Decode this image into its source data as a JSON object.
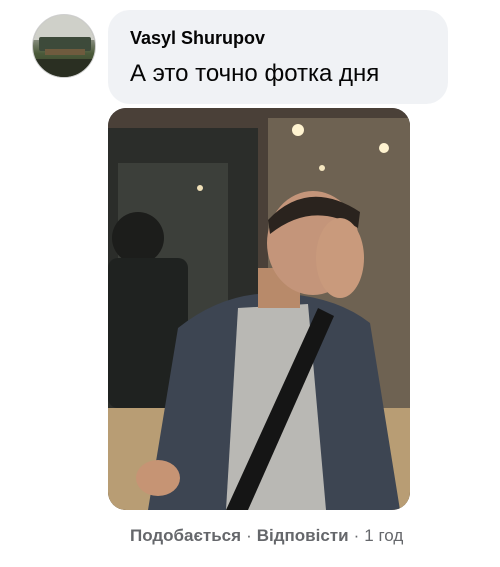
{
  "comment": {
    "author": "Vasyl Shurupov",
    "text": "А это точно фотка дня",
    "actions": {
      "like_label": "Подобається",
      "reply_label": "Відповісти",
      "separator": "·",
      "timestamp": "1 год"
    }
  }
}
